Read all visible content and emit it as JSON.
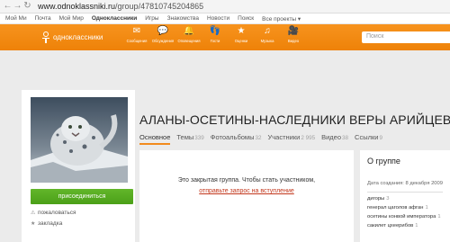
{
  "browser": {
    "back_icon": "back-arrow-icon",
    "forward_icon": "forward-arrow-icon",
    "reload_icon": "reload-icon",
    "url_domain": "www.odnoklassniki.ru",
    "url_path": "/group/47810745204865"
  },
  "topstrip": {
    "links": [
      "Мой Ми",
      "Почта",
      "Мой Мир",
      "Одноклассники",
      "Игры",
      "Знакомства",
      "Новости",
      "Поиск",
      "Все проекты ▾"
    ],
    "active_index": 3
  },
  "header": {
    "logo_text": "одноклассники",
    "icons": [
      {
        "name": "messages-icon",
        "label": "Сообщения",
        "glyph": "✉"
      },
      {
        "name": "discussions-icon",
        "label": "Обсуждения",
        "glyph": "💬"
      },
      {
        "name": "notifications-icon",
        "label": "Оповещения",
        "glyph": "🔔"
      },
      {
        "name": "guests-icon",
        "label": "Гости",
        "glyph": "👣"
      },
      {
        "name": "ratings-icon",
        "label": "Оценки",
        "glyph": "★"
      },
      {
        "name": "music-icon",
        "label": "Музыка",
        "glyph": "♫"
      },
      {
        "name": "video-icon",
        "label": "Видео",
        "glyph": "🎥"
      }
    ],
    "search_placeholder": "Поиск",
    "accent_color": "#f28b1d"
  },
  "group": {
    "title": "АЛАНЫ-ОСЕТИНЫ-НАСЛЕДНИКИ ВЕРЫ АРИЙЦЕВ .",
    "lock_icon": "lock-icon",
    "tabs": [
      {
        "label": "Основное",
        "count": ""
      },
      {
        "label": "Темы",
        "count": "339"
      },
      {
        "label": "Фотоальбомы",
        "count": "32"
      },
      {
        "label": "Участники",
        "count": "2 995"
      },
      {
        "label": "Видео",
        "count": "38"
      },
      {
        "label": "Ссылки",
        "count": "9"
      }
    ],
    "closed_message": "Это закрытая группа. Чтобы стать участником,",
    "request_link": "отправьте запрос на вступление"
  },
  "left": {
    "avatar_alt": "snow-leopard-avatar",
    "join_button": "присоединиться",
    "complain_label": "пожаловаться",
    "bookmark_label": "закладка"
  },
  "about": {
    "heading": "О группе",
    "created": "Дата создания: 8 декабря 2009",
    "categories": [
      {
        "label": "дигоры",
        "count": "3"
      },
      {
        "label": "генерал цаголов афган",
        "count": "1"
      },
      {
        "label": "осетины конвой императора",
        "count": "1"
      },
      {
        "label": "сакилет цхеерибов",
        "count": "1"
      }
    ]
  }
}
